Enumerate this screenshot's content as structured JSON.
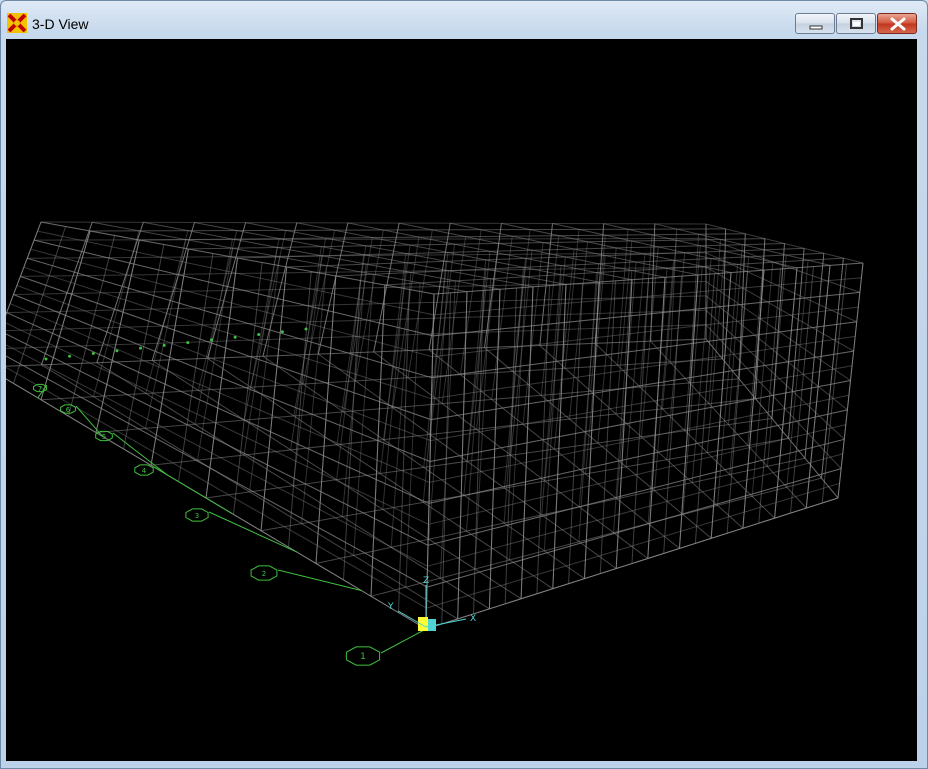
{
  "window": {
    "title": "3-D View"
  },
  "titlebar": {
    "icon": "app-logo-icon",
    "buttons": [
      "minimize-icon",
      "maximize-icon",
      "close-icon"
    ]
  },
  "viewport": {
    "background": "#000000",
    "wireframe_color": "#8c8c8c",
    "grid_bubble_color": "#3fbf3f",
    "axes": {
      "x_label": "X",
      "y_label": "Y",
      "z_label": "Z",
      "color": "#4fd4d4"
    },
    "grid_bubbles": [
      "1",
      "2",
      "3",
      "4",
      "5",
      "6",
      "7"
    ]
  }
}
